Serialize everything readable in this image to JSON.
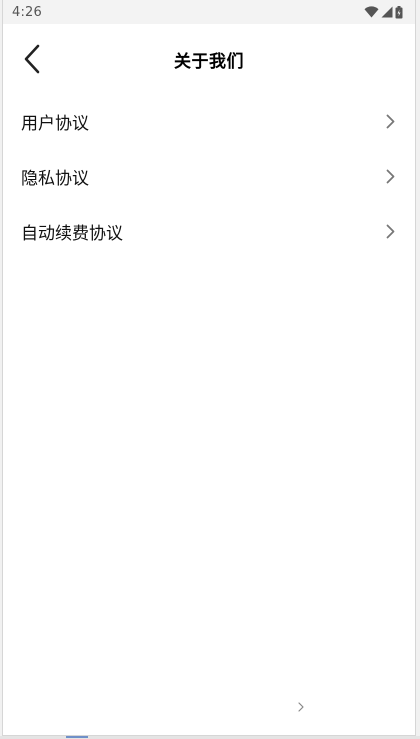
{
  "status_bar": {
    "time": "4:26",
    "icons": [
      "wifi-icon",
      "cell-signal-icon",
      "battery-icon"
    ]
  },
  "header": {
    "title": "关于我们",
    "back_icon": "chevron-left-icon"
  },
  "menu": {
    "items": [
      {
        "label": "用户协议",
        "icon": "chevron-right-icon"
      },
      {
        "label": "隐私协议",
        "icon": "chevron-right-icon"
      },
      {
        "label": "自动续费协议",
        "icon": "chevron-right-icon"
      }
    ]
  },
  "colors": {
    "background": "#ffffff",
    "status_bar": "#f3f3f3",
    "text": "#111111",
    "chevron": "#777777"
  }
}
